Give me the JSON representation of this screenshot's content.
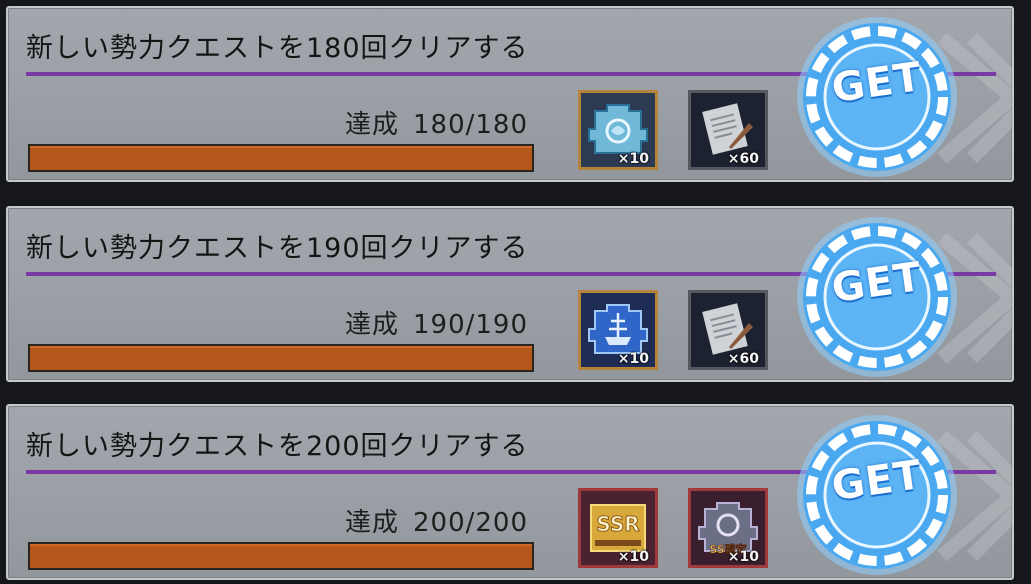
{
  "quests": [
    {
      "title": "新しい勢力クエストを180回クリアする",
      "progress_label": "達成",
      "progress_value": "180/180",
      "progress_fraction": 1.0,
      "rewards": [
        {
          "icon": "blue-crest-item-icon",
          "qty": "×10"
        },
        {
          "icon": "scroll-and-quill-icon",
          "qty": "×60"
        }
      ],
      "get_label": "GET"
    },
    {
      "title": "新しい勢力クエストを190回クリアする",
      "progress_label": "達成",
      "progress_value": "190/190",
      "progress_fraction": 1.0,
      "rewards": [
        {
          "icon": "blue-ship-crest-item-icon",
          "qty": "×10"
        },
        {
          "icon": "scroll-and-quill-icon",
          "qty": "×60"
        }
      ],
      "get_label": "GET"
    },
    {
      "title": "新しい勢力クエストを200回クリアする",
      "progress_label": "達成",
      "progress_value": "200/200",
      "progress_fraction": 1.0,
      "rewards": [
        {
          "icon": "ssr-ticket-icon",
          "qty": "×10",
          "badge": "SSR"
        },
        {
          "icon": "ssr-crest-icon",
          "qty": "×10",
          "badge": "SS確定"
        }
      ],
      "get_label": "GET"
    }
  ],
  "colors": {
    "progress_fill": "#b5561a",
    "divider": "#7a3aa6",
    "get_button": "#4aa8f0"
  }
}
